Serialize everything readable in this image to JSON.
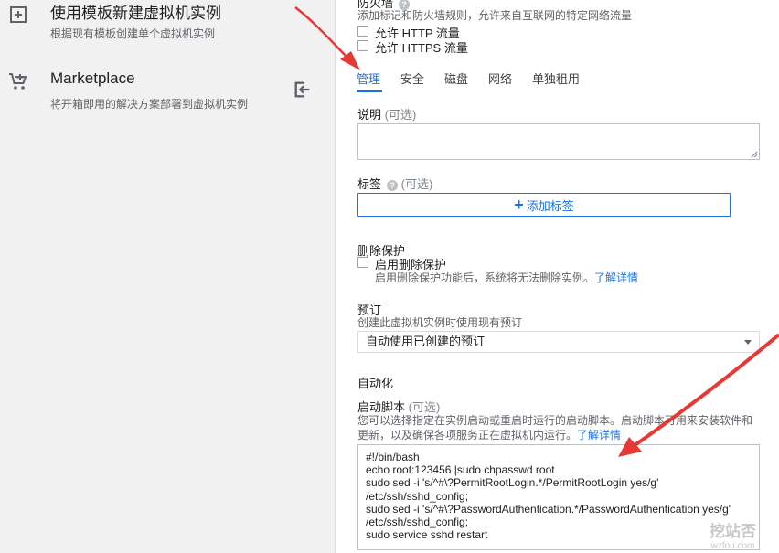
{
  "left_panel": {
    "template_item": {
      "title": "使用模板新建虚拟机实例",
      "subtitle": "根据现有模板创建单个虚拟机实例",
      "icon": "add-box-icon"
    },
    "marketplace_item": {
      "title": "Marketplace",
      "subtitle": "将开箱即用的解决方案部署到虚拟机实例",
      "icon": "cart-icon",
      "action_icon": "exit-icon"
    }
  },
  "firewall": {
    "title": "防火墙",
    "description": "添加标记和防火墙规则，允许来自互联网的特定网络流量",
    "http_label": "允许 HTTP 流量",
    "https_label": "允许 HTTPS 流量",
    "http_checked": false,
    "https_checked": false
  },
  "tabs": [
    {
      "label": "管理",
      "active": true
    },
    {
      "label": "安全",
      "active": false
    },
    {
      "label": "磁盘",
      "active": false
    },
    {
      "label": "网络",
      "active": false
    },
    {
      "label": "单独租用",
      "active": false
    }
  ],
  "description_field": {
    "label": "说明",
    "optional": "(可选)",
    "value": ""
  },
  "labels_field": {
    "label": "标签",
    "optional": "(可选)",
    "add_button": "添加标签"
  },
  "deletion_protection": {
    "title": "删除保护",
    "checkbox_label": "启用删除保护",
    "checked": false,
    "hint": "启用删除保护功能后，系统将无法删除实例。",
    "link": "了解详情"
  },
  "reservation": {
    "title": "预订",
    "hint": "创建此虚拟机实例时使用现有预订",
    "selected": "自动使用已创建的预订"
  },
  "automation": {
    "title": "自动化",
    "startup_label": "启动脚本",
    "optional": "(可选)",
    "hint_line1": "您可以选择指定在实例启动或重启时运行的启动脚本。启动脚本可用来安装软件和",
    "hint_line2": "更新，以及确保各项服务正在虚拟机内运行。",
    "link": "了解详情",
    "script_lines": [
      "#!/bin/bash",
      "echo root:123456 |sudo chpasswd root",
      "sudo sed -i 's/^#\\?PermitRootLogin.*/PermitRootLogin yes/g'",
      "/etc/ssh/sshd_config;",
      "sudo sed -i 's/^#\\?PasswordAuthentication.*/PasswordAuthentication yes/g'",
      "/etc/ssh/sshd_config;",
      "sudo service sshd restart"
    ]
  },
  "watermark": {
    "main": "挖站否",
    "sub": "wzfou.com"
  },
  "colors": {
    "accent": "#1a73e8",
    "annotation_arrow": "#e53935"
  }
}
